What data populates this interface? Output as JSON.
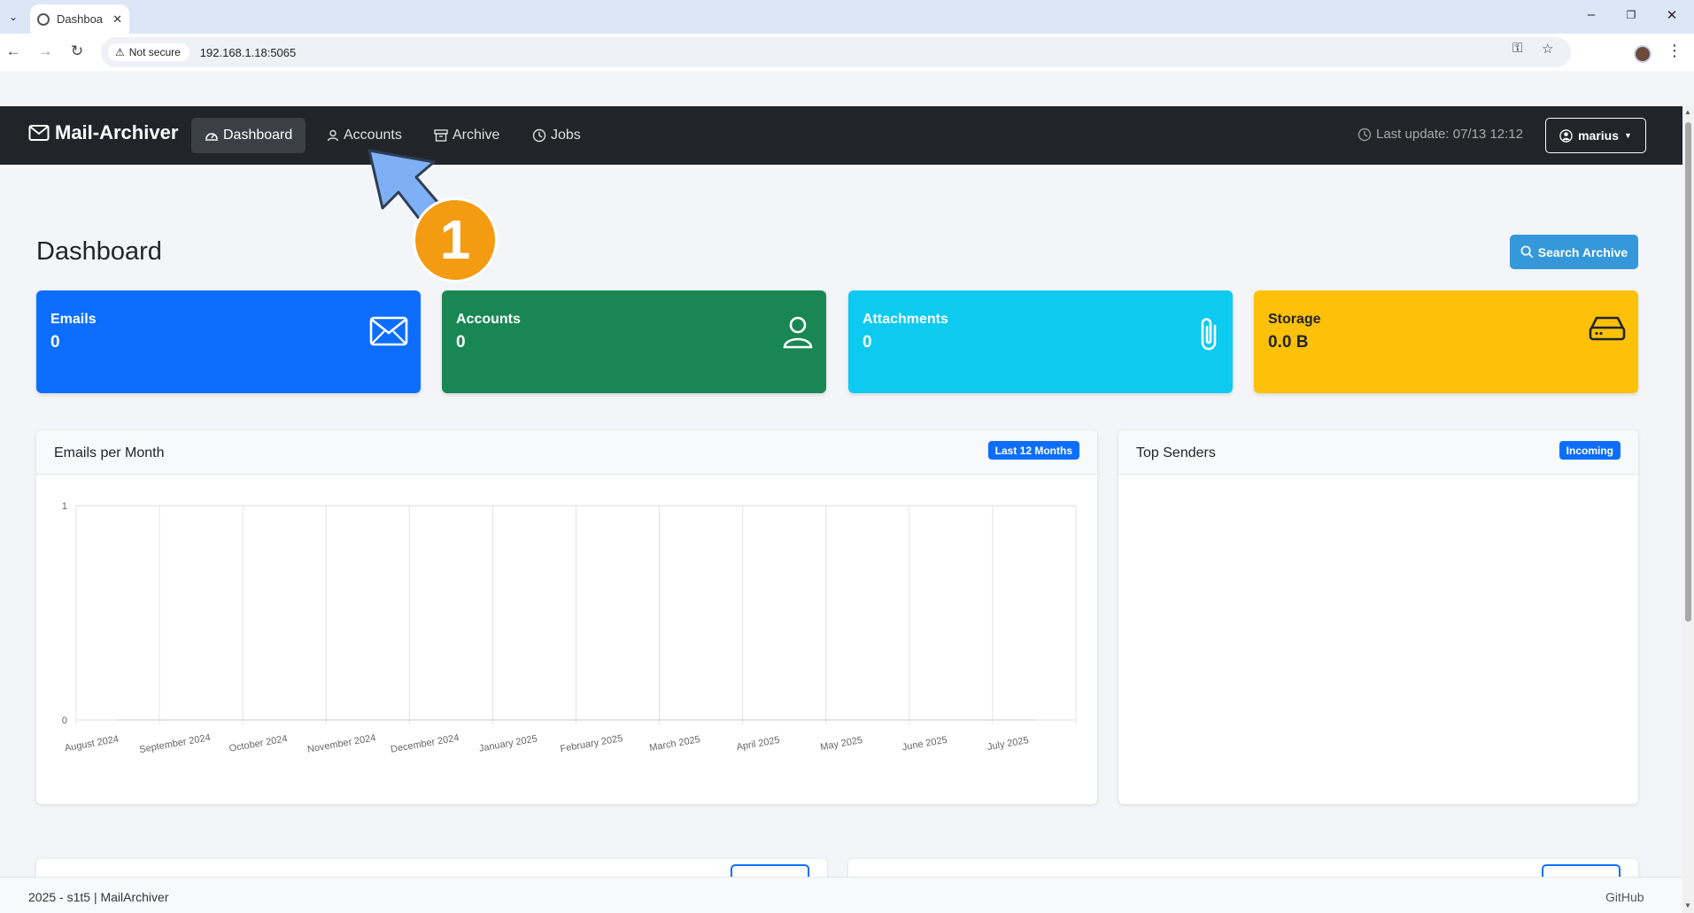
{
  "browser": {
    "tab_title": "Dashboa",
    "security_label": "Not secure",
    "url": "192.168.1.18:5065"
  },
  "navbar": {
    "brand": "Mail-Archiver",
    "links": [
      {
        "label": "Dashboard"
      },
      {
        "label": "Accounts"
      },
      {
        "label": "Archive"
      },
      {
        "label": "Jobs"
      }
    ],
    "last_update": "Last update: 07/13 12:12",
    "user": "marius"
  },
  "page": {
    "title": "Dashboard",
    "search_button": "Search Archive"
  },
  "stats": [
    {
      "label": "Emails",
      "value": "0",
      "color": "#0d6efd",
      "icon": "envelope-icon"
    },
    {
      "label": "Accounts",
      "value": "0",
      "color": "#198754",
      "icon": "person-icon"
    },
    {
      "label": "Attachments",
      "value": "0",
      "color": "#0dcaf0",
      "icon": "paperclip-icon"
    },
    {
      "label": "Storage",
      "value": "0.0 B",
      "color": "#ffc107",
      "icon": "hdd-icon"
    }
  ],
  "emails_panel": {
    "title": "Emails per Month",
    "badge": "Last 12 Months"
  },
  "senders_panel": {
    "title": "Top Senders",
    "badge": "Incoming"
  },
  "chart_data": {
    "type": "line",
    "categories": [
      "August 2024",
      "September 2024",
      "October 2024",
      "November 2024",
      "December 2024",
      "January 2025",
      "February 2025",
      "March 2025",
      "April 2025",
      "May 2025",
      "June 2025",
      "July 2025"
    ],
    "values": [
      0,
      0,
      0,
      0,
      0,
      0,
      0,
      0,
      0,
      0,
      0,
      0
    ],
    "yticks": [
      "0",
      "1"
    ],
    "ylim": [
      0,
      1
    ],
    "grid": true
  },
  "footer": {
    "left": "2025 - s1t5 | MailArchiver",
    "right": "GitHub"
  },
  "annotation": {
    "step": "1",
    "color": "#f39c12",
    "arrow_color": "#7fb0f5"
  }
}
